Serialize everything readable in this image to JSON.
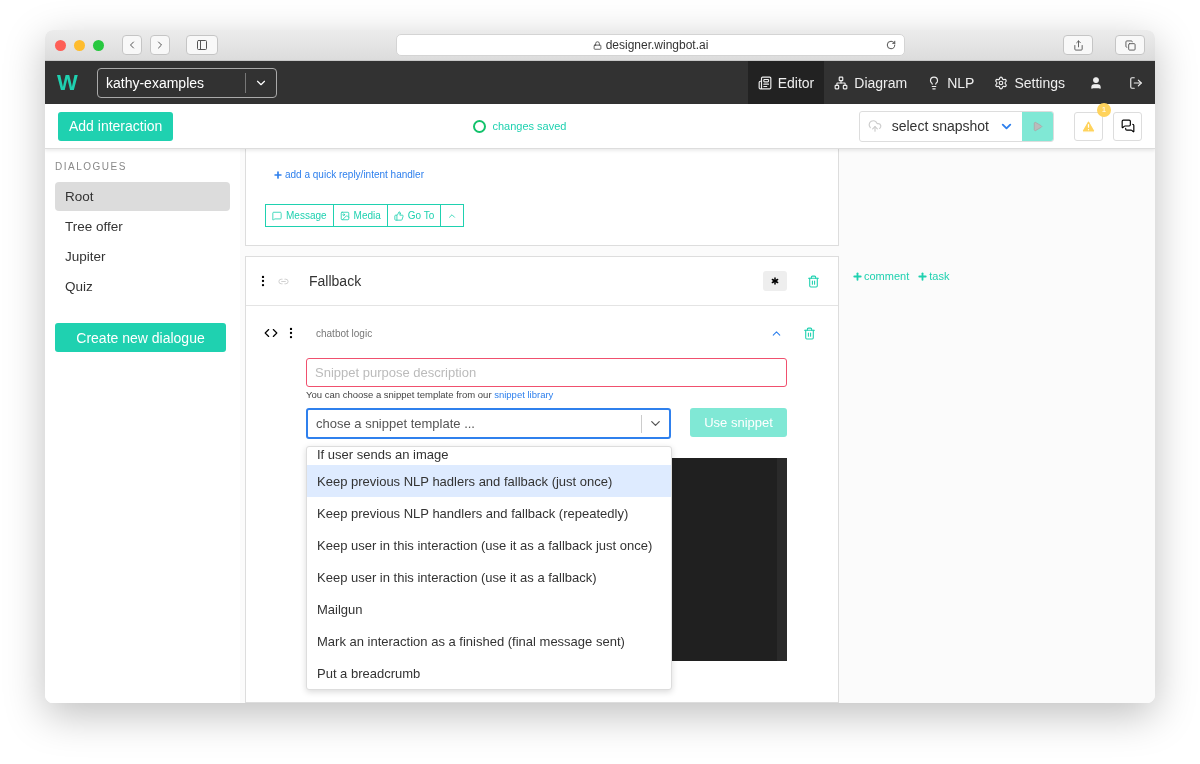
{
  "browser": {
    "url": "designer.wingbot.ai"
  },
  "app": {
    "logo": "W",
    "bot_select": "kathy-examples"
  },
  "nav": [
    {
      "label": "Editor",
      "kind": "editor",
      "selected": true
    },
    {
      "label": "Diagram",
      "kind": "diagram",
      "selected": false
    },
    {
      "label": "NLP",
      "kind": "nlp",
      "selected": false
    },
    {
      "label": "Settings",
      "kind": "settings",
      "selected": false
    }
  ],
  "toolbar": {
    "add_button": "Add interaction",
    "status": "changes saved",
    "snapshot_select": "select snapshot",
    "warnings_count": "1"
  },
  "sidebar": {
    "heading": "DIALOGUES",
    "items": [
      {
        "label": "Root",
        "selected": true
      },
      {
        "label": "Tree offer",
        "selected": false
      },
      {
        "label": "Jupiter",
        "selected": false
      },
      {
        "label": "Quiz",
        "selected": false
      }
    ],
    "create_button": "Create new dialogue"
  },
  "interaction": {
    "add_handler_link": "add a quick reply/intent handler",
    "add_buttons": [
      {
        "label": "Message",
        "kind": "message"
      },
      {
        "label": "Media",
        "kind": "media"
      },
      {
        "label": "Go To",
        "kind": "goto"
      }
    ]
  },
  "fallback": {
    "title": "Fallback",
    "block": {
      "title": "chatbot logic",
      "expanded": true,
      "description_placeholder": "Snippet purpose description",
      "help_text": "You can choose a snippet template from our",
      "help_link": "snippet library",
      "template_placeholder": "chose a snippet template ...",
      "use_button": {
        "label": "Use snippet",
        "disabled": true
      },
      "options": [
        {
          "label": "If user sends an image",
          "selected": false
        },
        {
          "label": "Keep previous NLP hadlers and fallback (just once)",
          "selected": true
        },
        {
          "label": "Keep previous NLP handlers and fallback (repeatedly)",
          "selected": false
        },
        {
          "label": "Keep user in this interaction (use it as a fallback just once)",
          "selected": false
        },
        {
          "label": "Keep user in this interaction (use it as a fallback)",
          "selected": false
        },
        {
          "label": "Mailgun",
          "selected": false
        },
        {
          "label": "Mark an interaction as a finished (final message sent)",
          "selected": false
        },
        {
          "label": "Put a breadcrumb",
          "selected": false
        }
      ]
    }
  },
  "notes": {
    "comment_link": "comment",
    "task_link": "task"
  }
}
